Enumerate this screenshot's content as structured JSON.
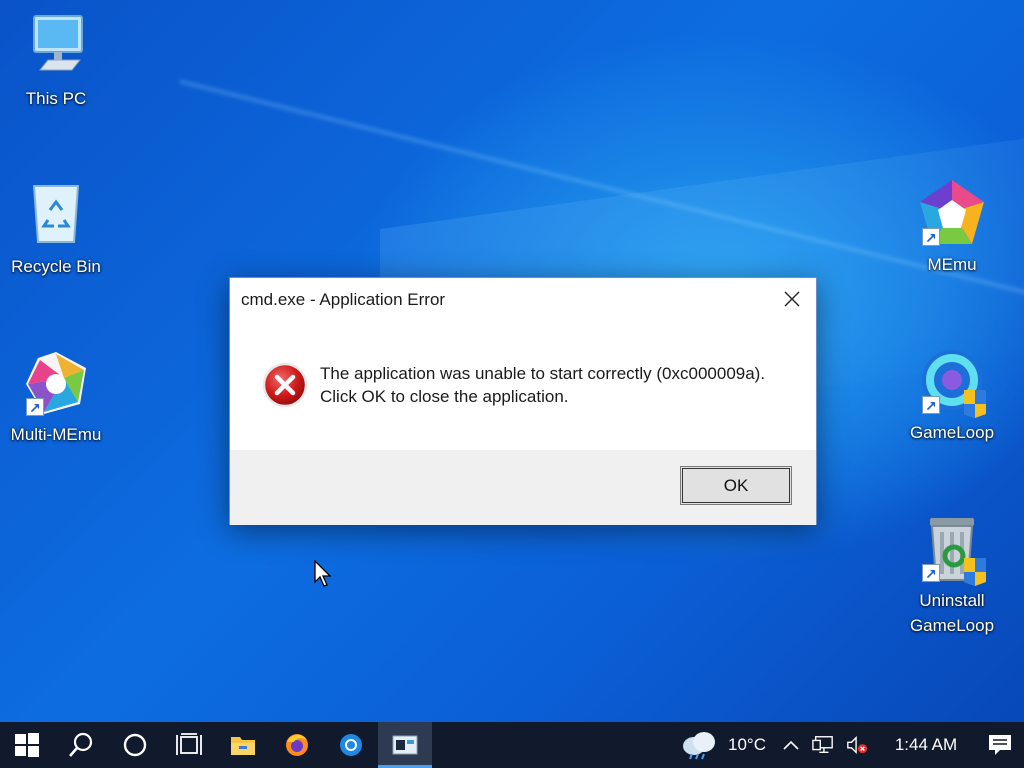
{
  "desktop_icons": [
    {
      "label": "This PC",
      "icon": "this-pc-icon"
    },
    {
      "label": "Recycle Bin",
      "icon": "recycle-bin-icon"
    },
    {
      "label": "Multi-MEmu",
      "icon": "multi-memu-icon"
    },
    {
      "label": "MEmu",
      "icon": "memu-icon"
    },
    {
      "label": "GameLoop",
      "icon": "gameloop-icon"
    },
    {
      "label_line1": "Uninstall",
      "label_line2": "GameLoop",
      "icon": "uninstall-gameloop-icon"
    }
  ],
  "dialog": {
    "title": "cmd.exe - Application Error",
    "message_line1": "The application was unable to start correctly (0xc000009a).",
    "message_line2": "Click OK to close the application.",
    "ok_label": "OK",
    "icon": "error-icon"
  },
  "taskbar": {
    "items": [
      "start-icon",
      "search-icon",
      "cortana-icon",
      "task-view-icon",
      "file-explorer-icon",
      "firefox-icon",
      "chrome-icon",
      "terminal-icon"
    ],
    "active_item": "terminal-icon"
  },
  "tray": {
    "weather": "10°C",
    "time": "1:44 AM",
    "icons": [
      "weather-cloud-icon",
      "chevron-up-icon",
      "network-icon",
      "volume-muted-icon",
      "notification-icon"
    ]
  },
  "colors": {
    "taskbar_bg": "#101a2c",
    "error_red": "#d01c1c",
    "dialog_footer": "#f0f0f0"
  }
}
